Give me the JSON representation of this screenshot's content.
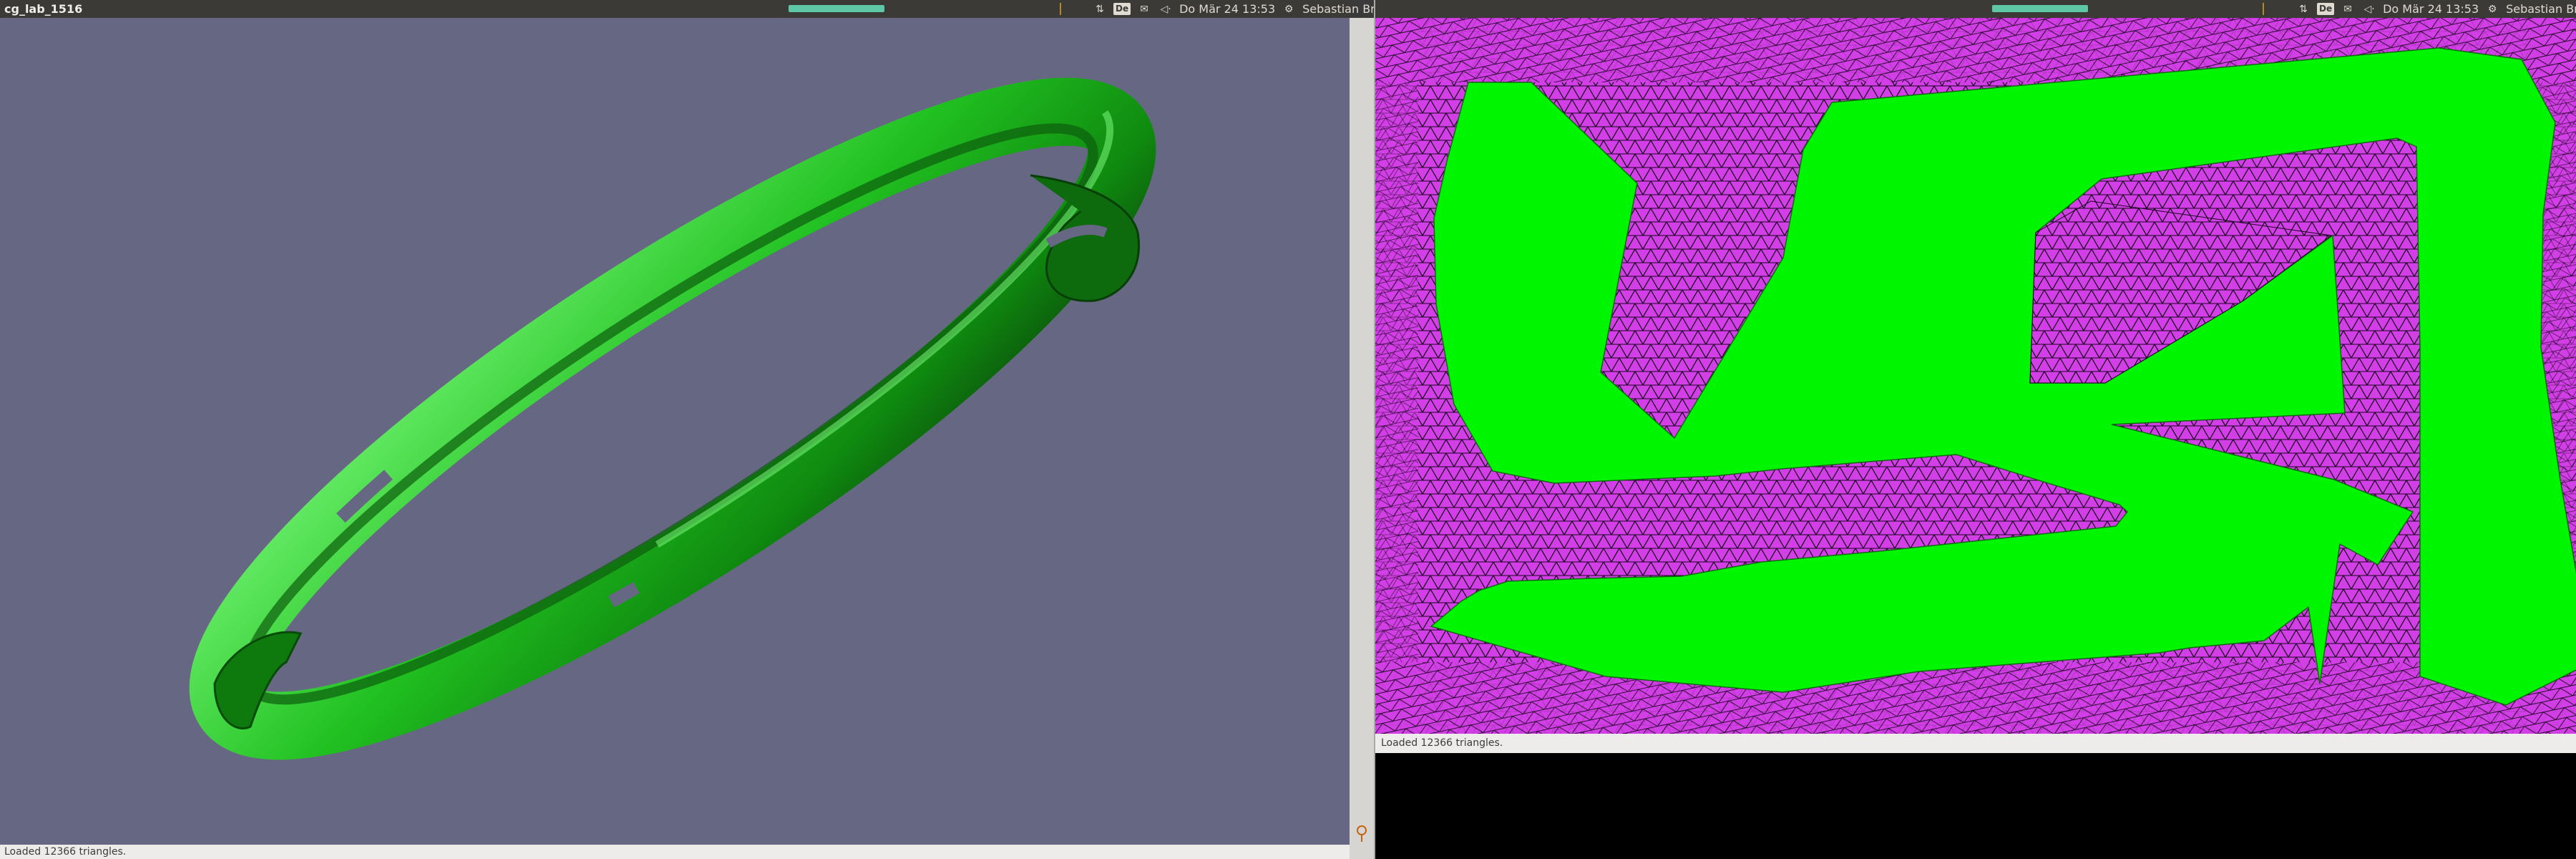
{
  "left_panel": {
    "window_title": "cg_lab_1516",
    "clock": "Do Mär 24 13:53",
    "user": "Sebastian Brodehl",
    "keyboard_layout": "De",
    "status_text": "Loaded 12366 triangles."
  },
  "right_panel": {
    "clock": "Do Mär 24 13:53",
    "user": "Sebastian Brodehl",
    "keyboard_layout": "De",
    "status_text": "Loaded 12366 triangles."
  },
  "colors": {
    "viewport_bg": "#666783",
    "mesh_fill": "#d33fe6",
    "shape_green": "#00f500",
    "ring_green": "#2fae2f"
  },
  "icons": [
    "sort-icon",
    "mail-icon",
    "sound-icon",
    "gear-icon"
  ]
}
